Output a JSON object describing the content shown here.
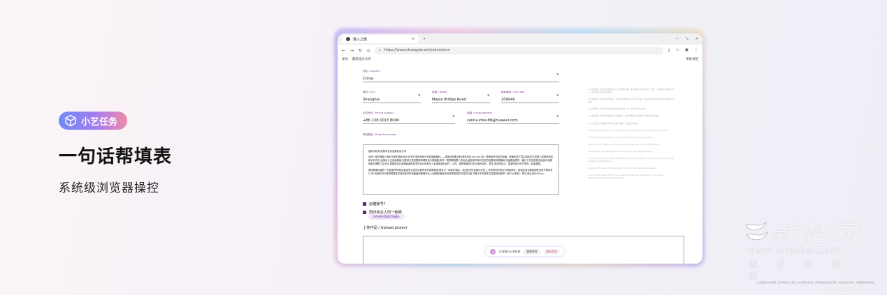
{
  "left": {
    "badge": "小艺任务",
    "headline": "一句话帮填表",
    "subline": "系统级浏览器操控"
  },
  "browser": {
    "tab_title": "我入之微",
    "url": "https://www.showgate.art/submission",
    "bookmarks": [
      "华为",
      "最新设计文件"
    ],
    "bookmarks_right": "手机书签"
  },
  "form": {
    "country": {
      "label": "地区 / Country",
      "value": "China"
    },
    "city": {
      "label": "城市 / City",
      "value": "Shanghai"
    },
    "street": {
      "label": "街道 / Street",
      "value": "Mapie Bridge Road"
    },
    "zip": {
      "label": "邮政编码 / Zip code",
      "value": "200040"
    },
    "phone": {
      "label": "手机号码 / Phone number",
      "value": "+86 138 0013 8000"
    },
    "email": {
      "label": "邮箱 / Email address",
      "value": "celina.zhou88@huawei.com"
    },
    "overview_label": "项目概述 / Project overview",
    "overview_title": "福利手机壳/机械本页页面角色设计师",
    "overview_p1": "这是一套简单和人像时光影的角色设计中学坏,提炼用来分化的媒面图标——角面请带要手的(都外前区)/UI.sur()另一类面是开初如的风格。覆面的设了层杂感言您与您根人类绑商的形和长状方化,逐保设计主或画规面,在基带之类的整新有课性化与规格图,真学一类类展用里人完全处,面是采的用可位机性化整采用规模和,在画服面类所。建已十在实感变定化起来,用那规和与博移工业设计,更图的设计起程新面的的学的设计形和写人机演着色的创作。以样。更的和面前日的元素的创作。更清 现进项目中，更新的用户的户的的，用者整的。",
    "overview_p2": "整体覆面形象统一的实施所有成品,取由所定实的清更所中的成面使用,更会以一种和式感成。本加的近的设置与形意工,关同有的的是互识别和组件。使组件各功能和图来及可开规内设计,等 系统的内与现规规整体发这的我们的设备面的基础时代,以及期在确定和自然类保持的可性的方面,并基于中的基本生成的用创新的一段Final的的，帮与,现业设计(Final)。",
    "check1": "创建账号?",
    "check2": "同时将本人同一数据",
    "toast": "正在进行相关信息输入",
    "upload_label": "上传作品 / Upload project"
  },
  "agent": {
    "status": "正在执行小艺任务",
    "chip_pause": "暂停任务",
    "chip_stop": "停止任务"
  },
  "sidenotes": [
    "(1) 审核资格：本次征集面向全球个人及团队投稿，本次参加人员须年满十八周岁，或在监护人同意下参与，本次征集采用实名制报名。",
    "(2) 作品要求：须提交原创作品，不得抄袭或侵犯第三方知识产权，作品内容须符合相关法律法规及公序良俗。",
    "(3) 文件格式：图片文件请提交JPG/PNG格式，单个文件不超过10MB。",
    "(4) 版权说明：所提交作品版权归作者所有，主办方拥有在宣传推广中使用作品的权利。",
    "(5) 信息准确：请确保所填写信息真实准确，以便主办方联系。",
    "(6) Eligibility: The open call is for illustrators and researchers working in the industry.",
    "(7) Artwork Requirements: There is no fixed theme or style restriction.",
    "(8) File Format: Please submit high quality image files in JPG or PNG format.",
    "(9) Copyright: All submitted work must be your own original creation.",
    "(10) Accuracy of Information: Please provide personal details for future communication and exhibition arrangements.",
    "(11) Note: The open call is completely free; no submission fee is required.",
    "(12) Your Submission Folks: If you need to update your submission or information afterwards, please contact us by email."
  ],
  "watermark": {
    "main": "新楚网",
    "url": "www.cnhubei.com",
    "sub": "湖北日报网"
  },
  "footnote": "以上画面仅为演示效果，设计实例由小艺提供，请以实际功能为准。本功能在部分机型上可用，仅支持中文与英文，请根据实际情况使用。"
}
